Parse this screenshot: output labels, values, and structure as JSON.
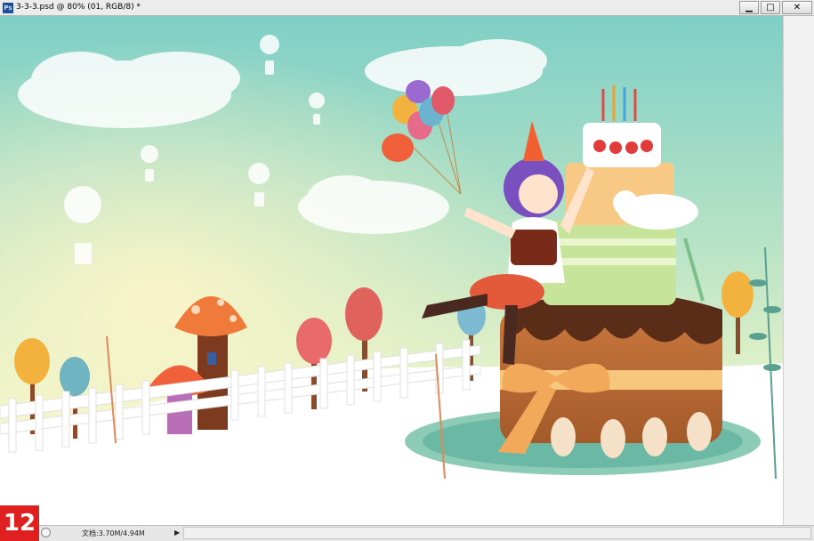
{
  "window": {
    "app_icon_text": "Ps",
    "title": "3-3-3.psd @ 80% (01, RGB/8) *",
    "minimize_glyph": "▁",
    "maximize_glyph": "□",
    "close_glyph": "✕"
  },
  "status": {
    "doc_info": "文档:3.70M/4.94M",
    "arrow_glyph": "▶"
  },
  "step_badge": "12",
  "icons": {
    "app": "photoshop-icon",
    "status_left": "status-menu-icon"
  },
  "colors": {
    "ps_blue": "#1d4f9a",
    "badge_red": "#e02020",
    "sky_teal": "#8fd0c8"
  }
}
